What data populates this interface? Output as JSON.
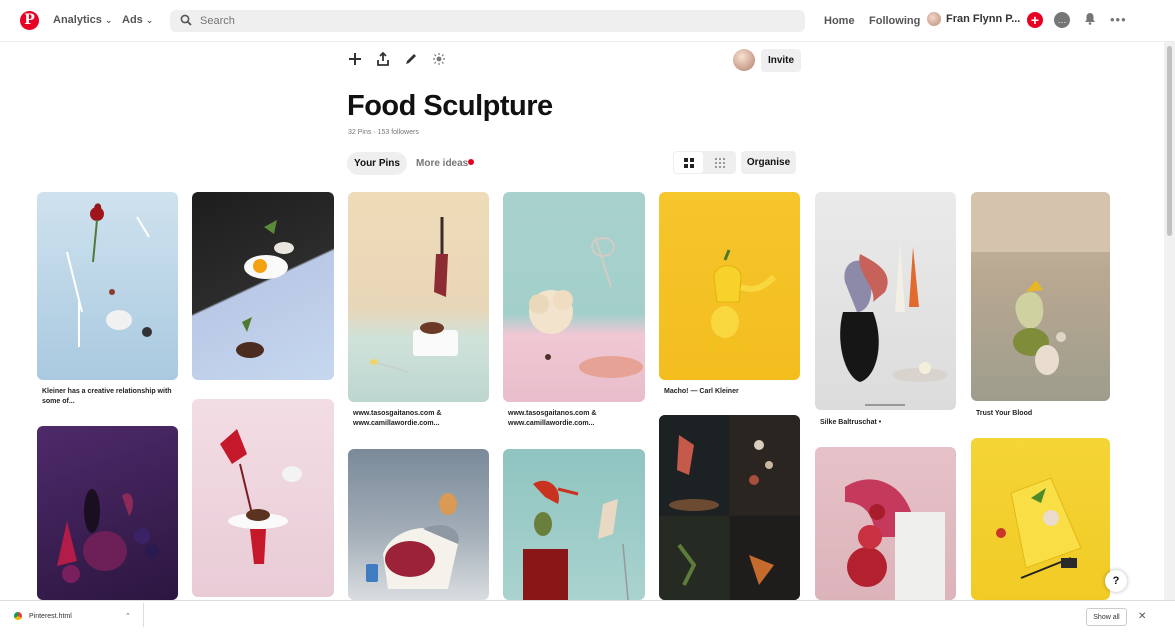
{
  "header": {
    "logo": "P",
    "analytics_label": "Analytics",
    "ads_label": "Ads",
    "search_placeholder": "Search",
    "home_label": "Home",
    "following_label": "Following",
    "user_name": "Fran Flynn P...",
    "more_glyph": "•••"
  },
  "board": {
    "invite_label": "Invite",
    "title": "Food Sculpture",
    "meta": "32 Pins · 153 followers",
    "tab_your_pins": "Your Pins",
    "tab_more_ideas": "More ideas",
    "organise_label": "Organise"
  },
  "pins": [
    {
      "label": "Kleiner has a creative relationship with some of..."
    },
    {
      "label": "www.tasosgaitanos.com & www.camillawordie.com..."
    },
    {
      "label": "www.tasosgaitanos.com & www.camillawordie.com..."
    },
    {
      "label": "Macho! — Carl Kleiner"
    },
    {
      "label": "Silke Baltruschat •"
    },
    {
      "label": "Trust Your Blood"
    }
  ],
  "help_label": "?",
  "download_bar": {
    "file_name": "Pinterest.html",
    "show_all_label": "Show all",
    "close_glyph": "✕"
  },
  "colors": {
    "brand": "#e60023"
  }
}
